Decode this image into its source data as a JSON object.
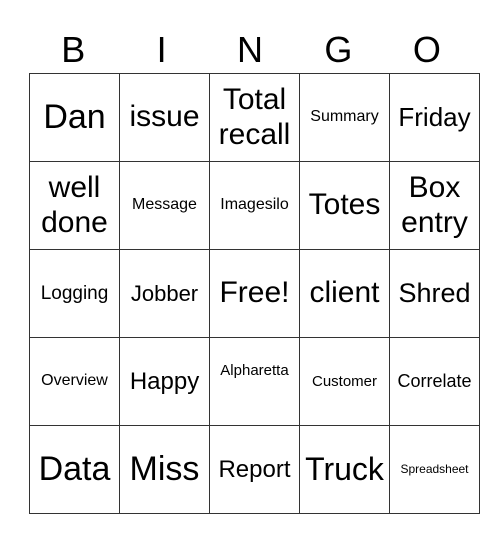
{
  "header": [
    "B",
    "I",
    "N",
    "G",
    "O"
  ],
  "rows": [
    [
      {
        "text": "Dan",
        "size": 34
      },
      {
        "text": "issue",
        "size": 30
      },
      {
        "text": "Total recall",
        "size": 30
      },
      {
        "text": "Summary",
        "size": 16
      },
      {
        "text": "Friday",
        "size": 26
      }
    ],
    [
      {
        "text": "well done",
        "size": 30
      },
      {
        "text": "Message",
        "size": 16
      },
      {
        "text": "Imagesilo",
        "size": 16
      },
      {
        "text": "Totes",
        "size": 30
      },
      {
        "text": "Box entry",
        "size": 30
      }
    ],
    [
      {
        "text": "Logging",
        "size": 19
      },
      {
        "text": "Jobber",
        "size": 22
      },
      {
        "text": "Free!",
        "size": 30
      },
      {
        "text": "client",
        "size": 30
      },
      {
        "text": "Shred",
        "size": 27
      }
    ],
    [
      {
        "text": "Overview",
        "size": 16
      },
      {
        "text": "Happy",
        "size": 24
      },
      {
        "text": "Alpharetta",
        "size": 15,
        "align": "top"
      },
      {
        "text": "Customer",
        "size": 15
      },
      {
        "text": "Correlate",
        "size": 18
      }
    ],
    [
      {
        "text": "Data",
        "size": 34
      },
      {
        "text": "Miss",
        "size": 34
      },
      {
        "text": "Report",
        "size": 24
      },
      {
        "text": "Truck",
        "size": 32
      },
      {
        "text": "Spreadsheet",
        "size": 12
      }
    ]
  ]
}
